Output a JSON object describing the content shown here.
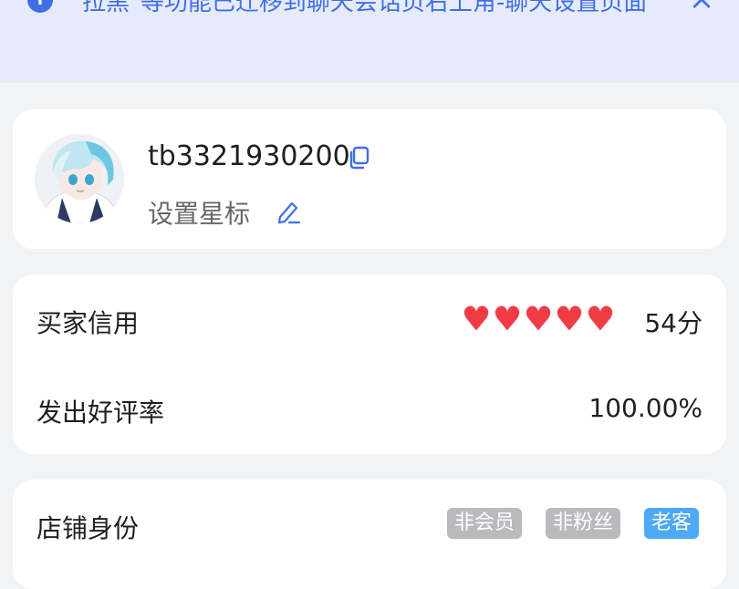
{
  "notice": {
    "text": "\"拉黑\"等功能已迁移到聊天会话页右上角-聊天设置页面",
    "info_icon": "info-icon",
    "close_icon": "close-icon",
    "accent_color": "#3f6fe6"
  },
  "profile": {
    "username": "tb3321930200",
    "star_label": "设置星标",
    "copy_icon": "copy-icon",
    "edit_icon": "pencil-icon"
  },
  "credit": {
    "buyer_credit_label": "买家信用",
    "hearts_count": 5,
    "heart_color": "#f03b45",
    "score": "54分",
    "positive_rate_label": "发出好评率",
    "positive_rate_value": "100.00%"
  },
  "shop": {
    "identity_label": "店铺身份",
    "tags": [
      {
        "label": "非会员",
        "color": "#b9babe"
      },
      {
        "label": "非粉丝",
        "color": "#b9babe"
      },
      {
        "label": "老客",
        "color": "#4da8f5"
      }
    ]
  }
}
